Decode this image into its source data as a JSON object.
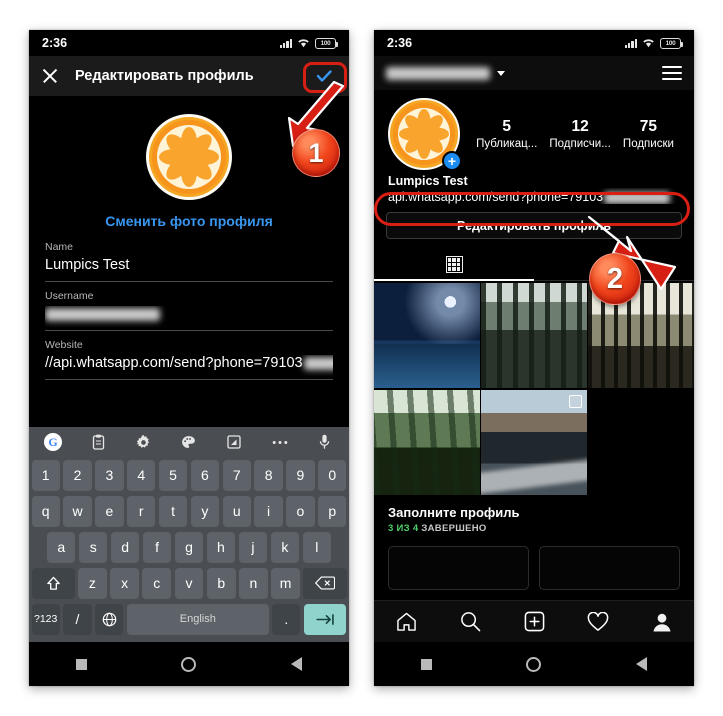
{
  "status_bar": {
    "time": "2:36",
    "battery": "100"
  },
  "left_phone": {
    "header": {
      "title": "Редактировать профиль",
      "close_icon": "close-icon",
      "confirm_icon": "check-icon"
    },
    "change_photo_label": "Сменить фото профиля",
    "fields": [
      {
        "label": "Name",
        "value": "Lumpics Test",
        "redacted": false
      },
      {
        "label": "Username",
        "value": "",
        "redacted": true
      },
      {
        "label": "Website",
        "value": "//api.whatsapp.com/send?phone=79103",
        "redacted": true
      }
    ],
    "keyboard": {
      "toolbar_icons": [
        "google-icon",
        "clipboard-icon",
        "gear-icon",
        "palette-icon",
        "sticker-icon",
        "more-icon",
        "microphone-icon"
      ],
      "row_numbers": [
        "1",
        "2",
        "3",
        "4",
        "5",
        "6",
        "7",
        "8",
        "9",
        "0"
      ],
      "row_q": [
        "q",
        "w",
        "e",
        "r",
        "t",
        "y",
        "u",
        "i",
        "o",
        "p"
      ],
      "row_a": [
        "a",
        "s",
        "d",
        "f",
        "g",
        "h",
        "j",
        "k",
        "l"
      ],
      "row_z": [
        "z",
        "x",
        "c",
        "v",
        "b",
        "n",
        "m"
      ],
      "shift_label": "⇧",
      "backspace_label": "⌫",
      "symbols_label": "?123",
      "slash_label": "/",
      "globe_label": "🌐",
      "space_label": "English",
      "period_label": ".",
      "enter_label": "→|"
    },
    "nav_icons": [
      "recents-square-icon",
      "home-circle-icon",
      "back-triangle-icon"
    ]
  },
  "right_phone": {
    "top_bar": {
      "username": "",
      "username_redacted": true,
      "chevron_icon": "chevron-down-icon",
      "menu_icon": "hamburger-menu-icon"
    },
    "stats": [
      {
        "value": "5",
        "label": "Публикац..."
      },
      {
        "value": "12",
        "label": "Подписчи..."
      },
      {
        "value": "75",
        "label": "Подписки"
      }
    ],
    "profile_name": "Lumpics Test",
    "profile_link": "api.whatsapp.com/send?phone=79103",
    "edit_button_label": "Редактировать профиль",
    "tabs": [
      {
        "icon": "grid-icon",
        "active": true
      },
      {
        "icon": "tagged-icon",
        "active": false
      }
    ],
    "grid_cells": [
      {
        "caption": "misty-castle-night-photo",
        "multi": false
      },
      {
        "caption": "foggy-forest-photo",
        "multi": false
      },
      {
        "caption": "birch-forest-photo",
        "multi": false
      },
      {
        "caption": "green-misty-woods-photo",
        "multi": false
      },
      {
        "caption": "black-sand-beach-photo",
        "multi": true
      },
      {
        "caption": "empty-cell",
        "multi": false
      }
    ],
    "complete_profile": {
      "title": "Заполните профиль",
      "progress_done": "3 ИЗ 4",
      "progress_rest": " ЗАВЕРШЕНО"
    },
    "bottom_nav": [
      "home-icon",
      "search-icon",
      "add-post-icon",
      "heart-icon",
      "profile-avatar-icon"
    ],
    "nav_icons": [
      "recents-square-icon",
      "home-circle-icon",
      "back-triangle-icon"
    ]
  },
  "annotations": {
    "accent_color": "#d81f14",
    "markers": [
      {
        "number": "1",
        "target": "confirm-check-button"
      },
      {
        "number": "2",
        "target": "profile-website-link"
      }
    ]
  }
}
